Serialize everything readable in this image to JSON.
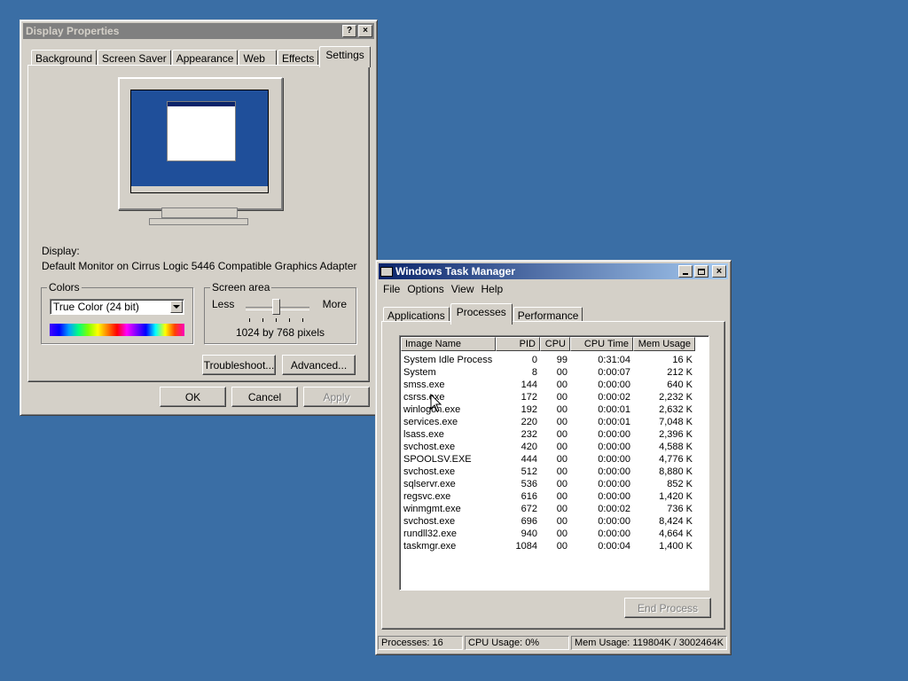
{
  "display": {
    "title": "Display Properties",
    "tabs": [
      "Background",
      "Screen Saver",
      "Appearance",
      "Web",
      "Effects",
      "Settings"
    ],
    "selected_tab": 5,
    "display_label": "Display:",
    "display_value": "Default Monitor on Cirrus Logic 5446 Compatible Graphics Adapter",
    "colors_legend": "Colors",
    "colors_value": "True Color (24 bit)",
    "screen_area_legend": "Screen area",
    "less": "Less",
    "more": "More",
    "resolution": "1024 by 768 pixels",
    "troubleshoot": "Troubleshoot...",
    "advanced": "Advanced...",
    "ok": "OK",
    "cancel": "Cancel",
    "apply": "Apply",
    "help_btn": "?",
    "close_btn": "×"
  },
  "taskmgr": {
    "title": "Windows Task Manager",
    "menu": [
      "File",
      "Options",
      "View",
      "Help"
    ],
    "tabs": [
      "Applications",
      "Processes",
      "Performance"
    ],
    "selected_tab": 1,
    "columns": [
      "Image Name",
      "PID",
      "CPU",
      "CPU Time",
      "Mem Usage"
    ],
    "rows": [
      [
        "System Idle Process",
        "0",
        "99",
        "0:31:04",
        "16 K"
      ],
      [
        "System",
        "8",
        "00",
        "0:00:07",
        "212 K"
      ],
      [
        "smss.exe",
        "144",
        "00",
        "0:00:00",
        "640 K"
      ],
      [
        "csrss.exe",
        "172",
        "00",
        "0:00:02",
        "2,232 K"
      ],
      [
        "winlogon.exe",
        "192",
        "00",
        "0:00:01",
        "2,632 K"
      ],
      [
        "services.exe",
        "220",
        "00",
        "0:00:01",
        "7,048 K"
      ],
      [
        "lsass.exe",
        "232",
        "00",
        "0:00:00",
        "2,396 K"
      ],
      [
        "svchost.exe",
        "420",
        "00",
        "0:00:00",
        "4,588 K"
      ],
      [
        "SPOOLSV.EXE",
        "444",
        "00",
        "0:00:00",
        "4,776 K"
      ],
      [
        "svchost.exe",
        "512",
        "00",
        "0:00:00",
        "8,880 K"
      ],
      [
        "sqlservr.exe",
        "536",
        "00",
        "0:00:00",
        "852 K"
      ],
      [
        "regsvc.exe",
        "616",
        "00",
        "0:00:00",
        "1,420 K"
      ],
      [
        "winmgmt.exe",
        "672",
        "00",
        "0:00:02",
        "736 K"
      ],
      [
        "svchost.exe",
        "696",
        "00",
        "0:00:00",
        "8,424 K"
      ],
      [
        "rundll32.exe",
        "940",
        "00",
        "0:00:00",
        "4,664 K"
      ],
      [
        "taskmgr.exe",
        "1084",
        "00",
        "0:00:04",
        "1,400 K"
      ]
    ],
    "end_process": "End Process",
    "status": {
      "processes": "Processes: 16",
      "cpu": "CPU Usage: 0%",
      "mem": "Mem Usage: 119804K / 3002464K"
    }
  },
  "colors": {
    "desktop": "#3a6ea5",
    "title_active": "#0a246a",
    "title_inactive": "#808080"
  }
}
